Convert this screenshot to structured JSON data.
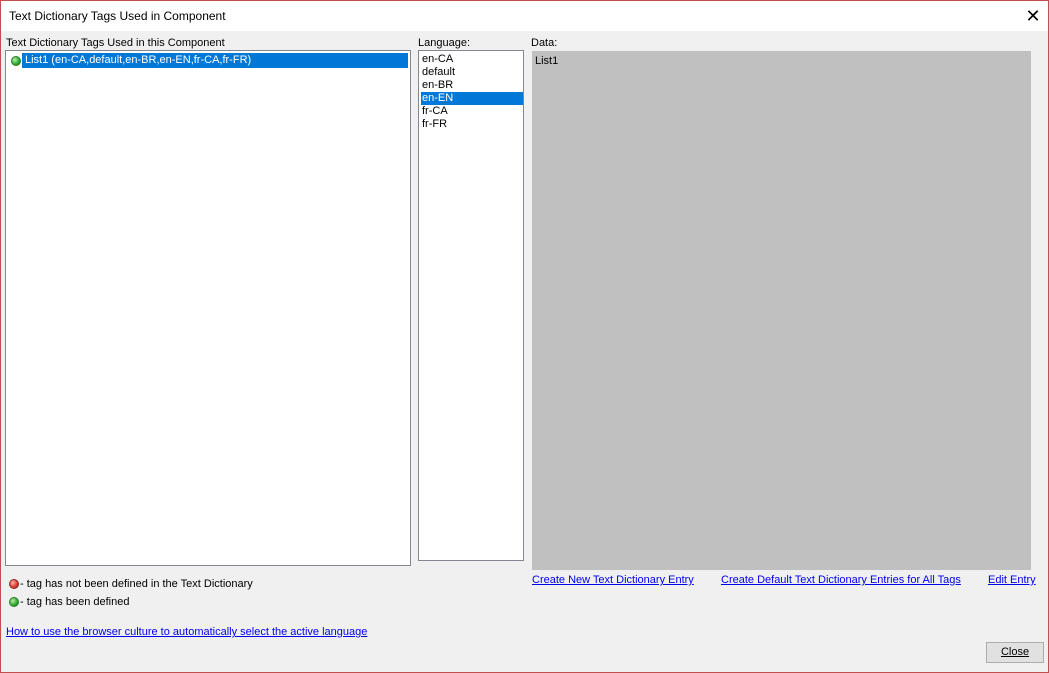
{
  "window": {
    "title": "Text Dictionary Tags Used in Component",
    "close_glyph": "✕"
  },
  "tags_panel": {
    "label": "Text Dictionary Tags Used in this Component",
    "items": [
      {
        "text": "List1 (en-CA,default,en-BR,en-EN,fr-CA,fr-FR)",
        "status": "defined",
        "icon": "green-dot-icon"
      }
    ]
  },
  "language_panel": {
    "label": "Language:",
    "items": [
      {
        "text": "en-CA",
        "selected": false
      },
      {
        "text": "default",
        "selected": false
      },
      {
        "text": "en-BR",
        "selected": false
      },
      {
        "text": "en-EN",
        "selected": true
      },
      {
        "text": "fr-CA",
        "selected": false
      },
      {
        "text": "fr-FR",
        "selected": false
      }
    ]
  },
  "data_panel": {
    "label": "Data:",
    "value": "List1"
  },
  "legend": {
    "undefined_text": " - tag has not been defined in the Text Dictionary",
    "defined_text": " - tag has been defined"
  },
  "links": {
    "create_new": "Create New Text Dictionary Entry",
    "create_default": "Create Default Text Dictionary Entries for All Tags",
    "edit_entry": "Edit Entry",
    "help": "How to use the browser culture to automatically select the active language"
  },
  "buttons": {
    "close": "Close"
  },
  "colors": {
    "selection": "#0078d7",
    "link": "#0000ee",
    "data_background": "#c0c0c0",
    "window_border": "#c05050"
  }
}
